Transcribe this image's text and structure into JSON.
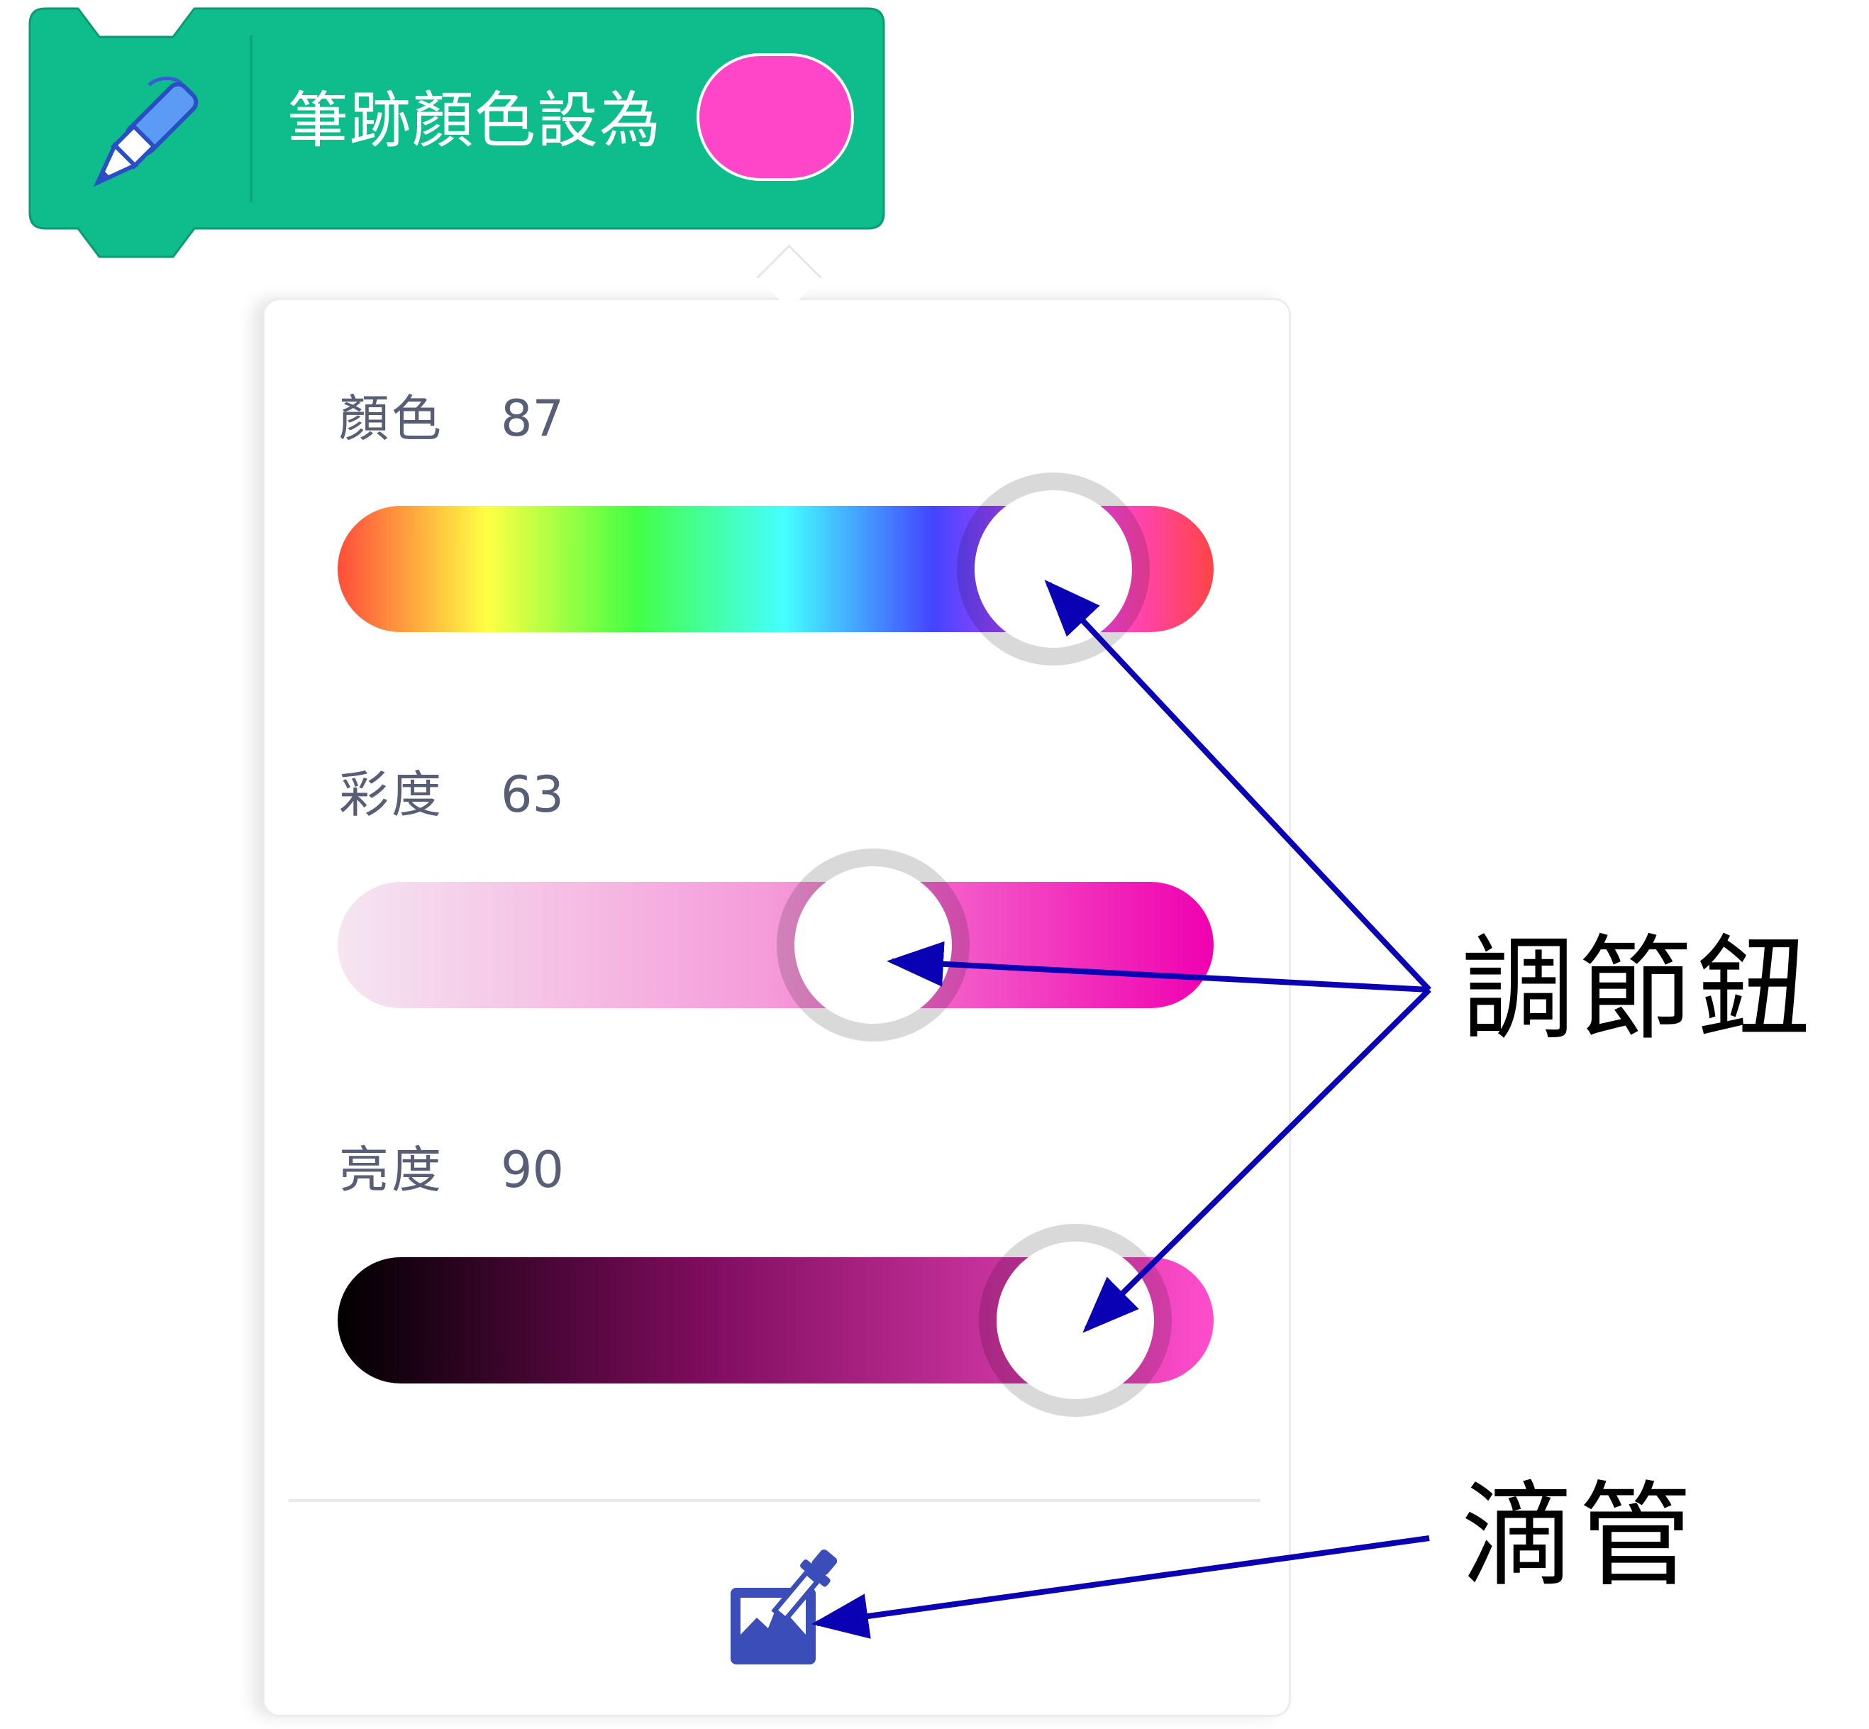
{
  "block": {
    "label": "筆跡顏色設為",
    "color": "#0fbd8c",
    "swatch_color": "#ff45c8",
    "icon": "pen-icon"
  },
  "sliders": [
    {
      "name": "顏色",
      "value": "87",
      "fraction": 0.87,
      "gradient": "linear-gradient(to right, #ff4d3a 0%, #ffff44 17%, #44ff44 34%, #44ffff 51%, #4444ff 68%, #ff44ff 85%, #ff4444 100%)"
    },
    {
      "name": "彩度",
      "value": "63",
      "fraction": 0.63,
      "gradient": "linear-gradient(to right, #f5e6f1 0%, #f59ad9 50%, #f000b0 100%)"
    },
    {
      "name": "亮度",
      "value": "90",
      "fraction": 0.9,
      "gradient": "linear-gradient(to right, #000000 0%, #7a0b5a 40%, #ff4dcc 100%)"
    }
  ],
  "eyedropper": {
    "icon": "eyedropper-icon",
    "color": "#3b4db8"
  },
  "annotations": {
    "knobs_label": "調節鈕",
    "eyedropper_label": "滴管",
    "arrow_color": "#0a00b4"
  }
}
